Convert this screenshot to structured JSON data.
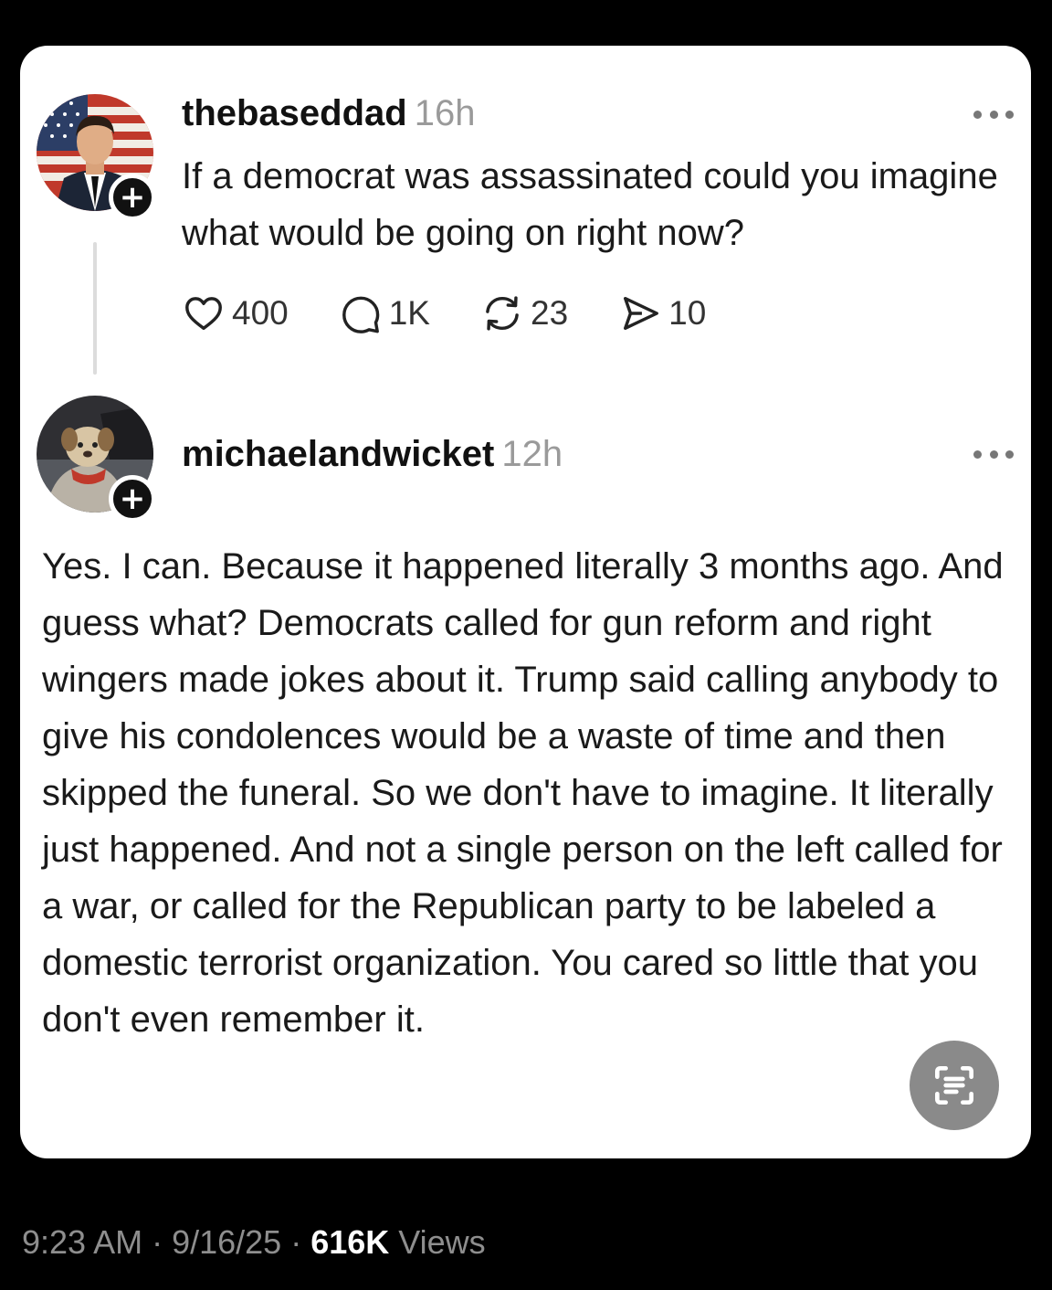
{
  "post": {
    "username": "thebaseddad",
    "time": "16h",
    "text": "If a democrat was assassinated could you imagine what would be going on right now?",
    "likes": "400",
    "comments": "1K",
    "reposts": "23",
    "shares": "10"
  },
  "reply": {
    "username": "michaelandwicket",
    "time": "12h",
    "text": "Yes. I can. Because it happened literally 3 months ago. And guess what? Democrats called for gun reform and right wingers made jokes about it. Trump said calling anybody to give his condolences would be a waste of time and then skipped the funeral. So we don't have to imagine. It literally just happened. And not a single person on the left called for a war, or called for the Republican party to be labeled a domestic terrorist organization. You cared so little that you don't even remember it."
  },
  "footer": {
    "time": "9:23 AM",
    "separator": " · ",
    "date": "9/16/25",
    "views_count": "616K",
    "views_label": " Views"
  },
  "icons": {
    "follow": "plus-icon",
    "more": "more-dots-icon",
    "like": "heart-icon",
    "comment": "comment-bubble-icon",
    "repost": "repost-icon",
    "share": "send-icon",
    "scan": "text-scan-icon"
  }
}
